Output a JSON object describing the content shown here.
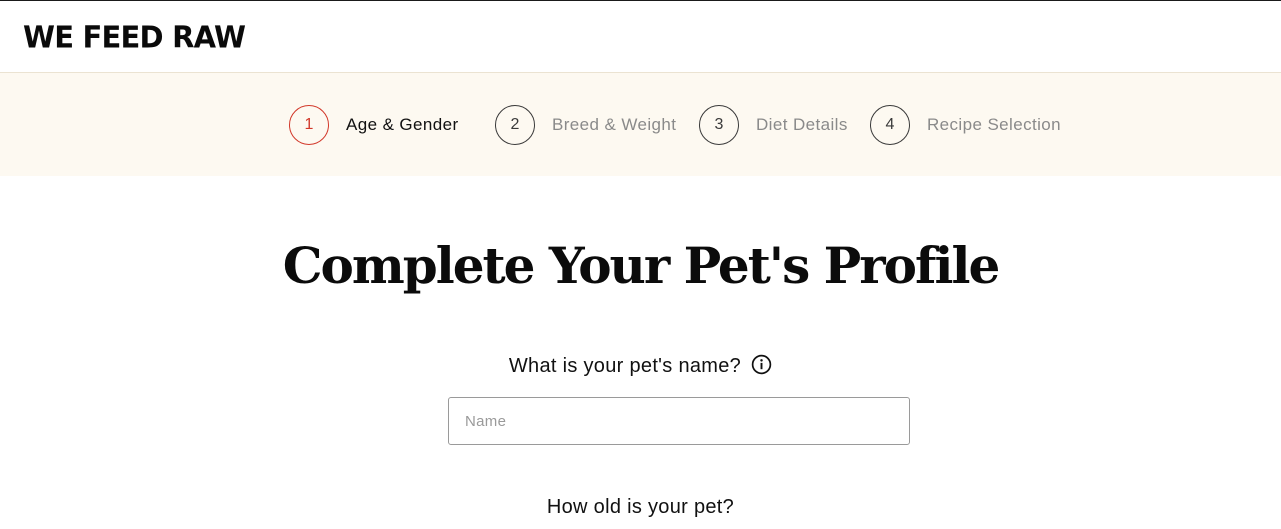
{
  "header": {
    "logo_text": "WE FEED RAW"
  },
  "stepper": {
    "steps": [
      {
        "number": "1",
        "label": "Age & Gender",
        "active": true
      },
      {
        "number": "2",
        "label": "Breed & Weight",
        "active": false
      },
      {
        "number": "3",
        "label": "Diet Details",
        "active": false
      },
      {
        "number": "4",
        "label": "Recipe Selection",
        "active": false
      }
    ]
  },
  "main": {
    "title": "Complete Your Pet's Profile",
    "name_question": "What is your pet's name?",
    "name_placeholder": "Name",
    "name_value": "",
    "age_question": "How old is your pet?"
  },
  "icons": {
    "info": "info-icon"
  },
  "colors": {
    "active_step": "#d2382a",
    "stepper_background": "#fdf9f1",
    "inactive_text": "#8a8a8a"
  }
}
